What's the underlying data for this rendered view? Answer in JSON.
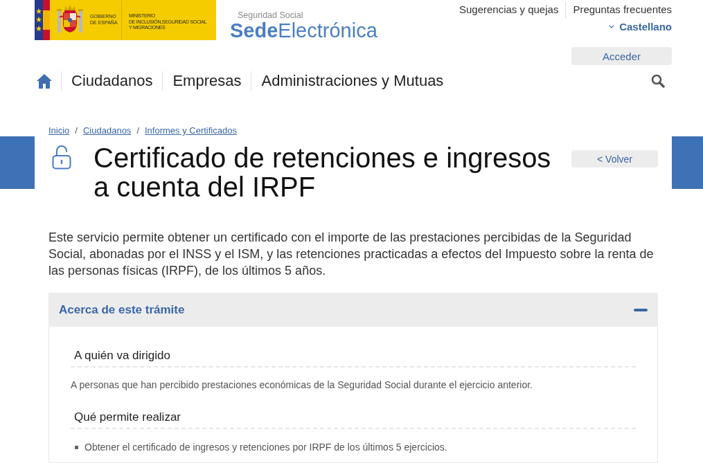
{
  "header": {
    "gov_logo": {
      "name_lines": [
        "GOBIERNO",
        "DE ESPAÑA"
      ],
      "ministry_lines": [
        "MINISTERIO",
        "DE INCLUSIÓN,SEGURIDAD SOCIAL",
        "Y MIGRACIONES"
      ]
    },
    "site_logo": {
      "subtitle": "Seguridad Social",
      "wordmark": "**Sede**Electrónica"
    },
    "top_links": [
      "Sugerencias y quejas",
      "Preguntas frecuentes"
    ],
    "language": "Castellano",
    "login_button": "Acceder"
  },
  "nav": {
    "items": [
      "Ciudadanos",
      "Empresas",
      "Administraciones y Mutuas"
    ]
  },
  "breadcrumb": {
    "separator": "/",
    "items": [
      "Inicio",
      "Ciudadanos",
      "Informes y Certificados"
    ]
  },
  "page": {
    "title": "Certificado de retenciones e ingresos a cuenta del IRPF",
    "back_button": "< Volver",
    "intro": "Este servicio permite obtener un certificado con el importe de las prestaciones percibidas de la Seguridad Social, abonadas por el INSS y el ISM, y las retenciones practicadas a efectos del Impuesto sobre la renta de las personas físicas (IRPF), de los últimos 5 años."
  },
  "accordion": {
    "title": "Acerca de este trámite",
    "expanded": true,
    "sections": [
      {
        "kind": "text",
        "heading": "A quién va dirigido",
        "text": "A personas que han percibido prestaciones económicas de la Seguridad Social durante el ejercicio anterior."
      },
      {
        "kind": "list",
        "heading": "Qué permite realizar",
        "items": [
          "Obtener el certificado de ingresos y retenciones por IRPF de los últimos 5 ejercicios."
        ]
      }
    ]
  }
}
